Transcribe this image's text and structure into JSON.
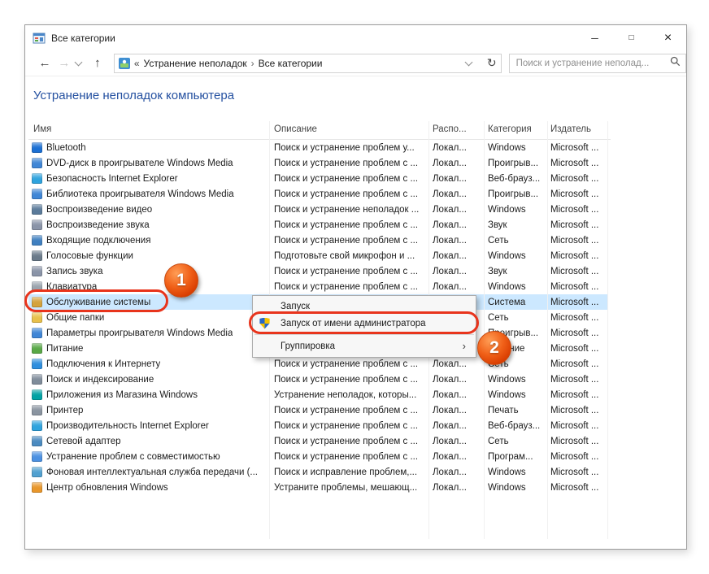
{
  "window": {
    "title": "Все категории",
    "controls": {
      "minimize": "─",
      "maximize": "□",
      "close": "×"
    }
  },
  "navbar": {
    "back": "←",
    "forward": "→",
    "up": "↑",
    "refresh": "↻",
    "overflow_chevron": "«",
    "crumb_separator": "›",
    "breadcrumb": [
      "Устранение неполадок",
      "Все категории"
    ],
    "search_placeholder": "Поиск и устранение неполад..."
  },
  "page": {
    "heading": "Устранение неполадок компьютера"
  },
  "table": {
    "columns": [
      "Имя",
      "Описание",
      "Распо...",
      "Категория",
      "Издатель"
    ],
    "rows": [
      {
        "icon": "bluetooth-icon",
        "color": "#1a6fd4",
        "name": "Bluetooth",
        "desc": "Поиск и устранение проблем у...",
        "loc": "Локал...",
        "cat": "Windows",
        "pub": "Microsoft ...",
        "selected": false
      },
      {
        "icon": "wmp-dvd-icon",
        "color": "#3f86d6",
        "name": "DVD-диск в проигрывателе Windows Media",
        "desc": "Поиск и устранение проблем с ...",
        "loc": "Локал...",
        "cat": "Проигрыв...",
        "pub": "Microsoft ...",
        "selected": false
      },
      {
        "icon": "ie-security-icon",
        "color": "#2ea3de",
        "name": "Безопасность Internet Explorer",
        "desc": "Поиск и устранение проблем с ...",
        "loc": "Локал...",
        "cat": "Веб-брауз...",
        "pub": "Microsoft ...",
        "selected": false
      },
      {
        "icon": "wmp-library-icon",
        "color": "#3f86d6",
        "name": "Библиотека проигрывателя Windows Media",
        "desc": "Поиск и устранение проблем с ...",
        "loc": "Локал...",
        "cat": "Проигрыв...",
        "pub": "Microsoft ...",
        "selected": false
      },
      {
        "icon": "video-playback-icon",
        "color": "#5a7a9a",
        "name": "Воспроизведение видео",
        "desc": "Поиск и устранение неполадок ...",
        "loc": "Локал...",
        "cat": "Windows",
        "pub": "Microsoft ...",
        "selected": false
      },
      {
        "icon": "audio-playback-icon",
        "color": "#8a94a8",
        "name": "Воспроизведение звука",
        "desc": "Поиск и устранение проблем с ...",
        "loc": "Локал...",
        "cat": "Звук",
        "pub": "Microsoft ...",
        "selected": false
      },
      {
        "icon": "incoming-connections-icon",
        "color": "#3f7fc0",
        "name": "Входящие подключения",
        "desc": "Поиск и устранение проблем с ...",
        "loc": "Локал...",
        "cat": "Сеть",
        "pub": "Microsoft ...",
        "selected": false
      },
      {
        "icon": "speech-icon",
        "color": "#6a7a8a",
        "name": "Голосовые функции",
        "desc": "Подготовьте свой микрофон и ...",
        "loc": "Локал...",
        "cat": "Windows",
        "pub": "Microsoft ...",
        "selected": false
      },
      {
        "icon": "sound-recording-icon",
        "color": "#8a94a8",
        "name": "Запись звука",
        "desc": "Поиск и устранение проблем с ...",
        "loc": "Локал...",
        "cat": "Звук",
        "pub": "Microsoft ...",
        "selected": false
      },
      {
        "icon": "keyboard-icon",
        "color": "#9aa4ae",
        "name": "Клавиатура",
        "desc": "Поиск и устранение проблем с ...",
        "loc": "Локал...",
        "cat": "Windows",
        "pub": "Microsoft ...",
        "selected": false
      },
      {
        "icon": "system-maintenance-icon",
        "color": "#d4a23a",
        "name": "Обслуживание системы",
        "desc": "",
        "loc": "",
        "cat": "Система",
        "pub": "Microsoft ...",
        "selected": true
      },
      {
        "icon": "shared-folders-icon",
        "color": "#e8c04a",
        "name": "Общие папки",
        "desc": "",
        "loc": "",
        "cat": "Сеть",
        "pub": "Microsoft ...",
        "selected": false
      },
      {
        "icon": "wmp-settings-icon",
        "color": "#3f86d6",
        "name": "Параметры проигрывателя Windows Media",
        "desc": "",
        "loc": "",
        "cat": "Проигрыв...",
        "pub": "Microsoft ...",
        "selected": false
      },
      {
        "icon": "power-icon",
        "color": "#58a846",
        "name": "Питание",
        "desc": "",
        "loc": "",
        "cat": "Питание",
        "pub": "Microsoft ...",
        "selected": false
      },
      {
        "icon": "internet-connections-icon",
        "color": "#2e8ede",
        "name": "Подключения к Интернету",
        "desc": "Поиск и устранение проблем с ...",
        "loc": "Локал...",
        "cat": "Сеть",
        "pub": "Microsoft ...",
        "selected": false
      },
      {
        "icon": "search-indexing-icon",
        "color": "#7f8c9a",
        "name": "Поиск и индексирование",
        "desc": "Поиск и устранение проблем с ...",
        "loc": "Локал...",
        "cat": "Windows",
        "pub": "Microsoft ...",
        "selected": false
      },
      {
        "icon": "store-apps-icon",
        "color": "#00a2a4",
        "name": "Приложения из Магазина Windows",
        "desc": "Устранение неполадок, которы...",
        "loc": "Локал...",
        "cat": "Windows",
        "pub": "Microsoft ...",
        "selected": false
      },
      {
        "icon": "printer-icon",
        "color": "#8a94a0",
        "name": "Принтер",
        "desc": "Поиск и устранение проблем с ...",
        "loc": "Локал...",
        "cat": "Печать",
        "pub": "Microsoft ...",
        "selected": false
      },
      {
        "icon": "ie-performance-icon",
        "color": "#2ea3de",
        "name": "Производительность Internet Explorer",
        "desc": "Поиск и устранение проблем с ...",
        "loc": "Локал...",
        "cat": "Веб-брауз...",
        "pub": "Microsoft ...",
        "selected": false
      },
      {
        "icon": "network-adapter-icon",
        "color": "#4a8ac0",
        "name": "Сетевой адаптер",
        "desc": "Поиск и устранение проблем с ...",
        "loc": "Локал...",
        "cat": "Сеть",
        "pub": "Microsoft ...",
        "selected": false
      },
      {
        "icon": "compatibility-icon",
        "color": "#4a90e2",
        "name": "Устранение проблем с совместимостью",
        "desc": "Поиск и устранение проблем с ...",
        "loc": "Локал...",
        "cat": "Програм...",
        "pub": "Microsoft ...",
        "selected": false
      },
      {
        "icon": "bits-icon",
        "color": "#50a0d0",
        "name": "Фоновая интеллектуальная служба передачи (...",
        "desc": "Поиск и исправление проблем,...",
        "loc": "Локал...",
        "cat": "Windows",
        "pub": "Microsoft ...",
        "selected": false
      },
      {
        "icon": "windows-update-icon",
        "color": "#e8962a",
        "name": "Центр обновления Windows",
        "desc": "Устраните проблемы, мешающ...",
        "loc": "Локал...",
        "cat": "Windows",
        "pub": "Microsoft ...",
        "selected": false
      }
    ]
  },
  "context_menu": {
    "items": [
      {
        "id": "run",
        "label": "Запуск",
        "icon": null,
        "submenu": false,
        "separator_before": false
      },
      {
        "id": "run-as-admin",
        "label": "Запуск от имени администратора",
        "icon": "uac-shield-icon",
        "submenu": false,
        "separator_before": false
      },
      {
        "id": "grouping",
        "label": "Группировка",
        "icon": null,
        "submenu": true,
        "separator_before": true
      }
    ],
    "submenu_arrow": "›"
  },
  "annotations": {
    "badges": [
      {
        "label": "1"
      },
      {
        "label": "2"
      }
    ]
  },
  "colors": {
    "heading": "#2450a0",
    "selection": "#cce8ff",
    "annotation": "#e8341c"
  }
}
